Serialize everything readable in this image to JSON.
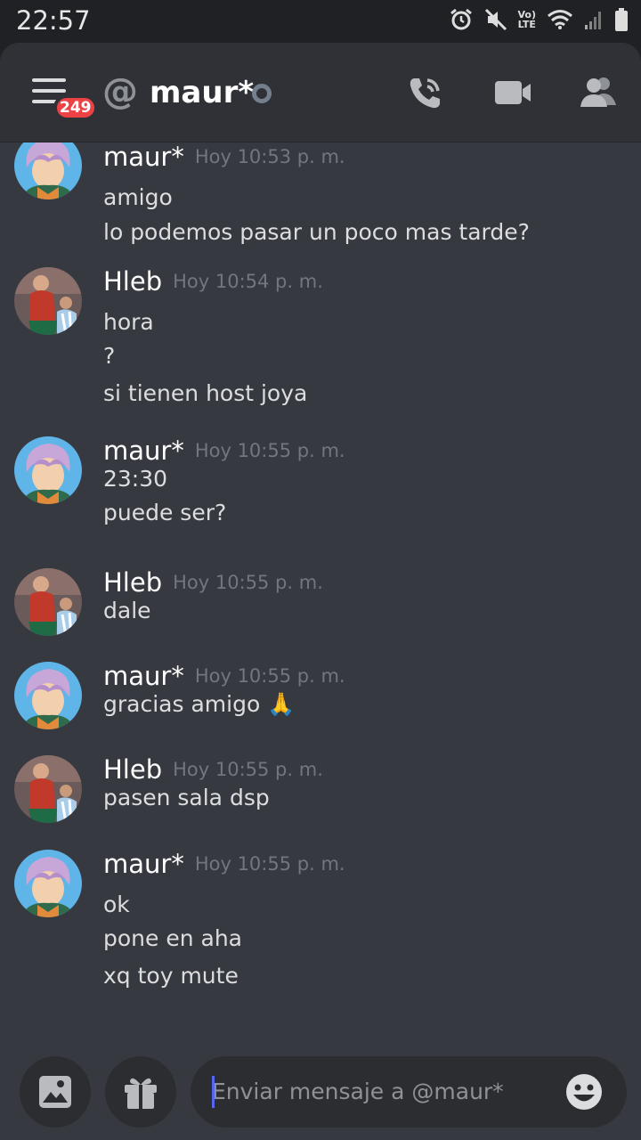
{
  "status_bar": {
    "time": "22:57",
    "volte_line1": "Vo)",
    "volte_line2": "LTE"
  },
  "header": {
    "badge_count": "249",
    "at_symbol": "@",
    "title": "maur*",
    "icons": [
      "hamburger-menu-icon",
      "phone-call-icon",
      "video-camera-icon",
      "members-icon"
    ]
  },
  "messages": [
    {
      "author": "maur*",
      "time": "Hoy 10:53 p. m.",
      "avatar": "maur",
      "lines": [
        "amigo",
        "lo podemos pasar un poco mas tarde?"
      ]
    },
    {
      "author": "Hleb",
      "time": "Hoy 10:54 p. m.",
      "avatar": "hleb",
      "lines": [
        "hora",
        "?",
        "si tienen host joya"
      ]
    },
    {
      "author": "maur*",
      "time": "Hoy 10:55 p. m.",
      "avatar": "maur",
      "lines": [
        "23:30",
        "puede ser?"
      ]
    },
    {
      "author": "Hleb",
      "time": "Hoy 10:55 p. m.",
      "avatar": "hleb",
      "lines": [
        "dale"
      ]
    },
    {
      "author": "maur*",
      "time": "Hoy 10:55 p. m.",
      "avatar": "maur",
      "lines": [
        "gracias amigo 🙏"
      ]
    },
    {
      "author": "Hleb",
      "time": "Hoy 10:55 p. m.",
      "avatar": "hleb",
      "lines": [
        "pasen sala dsp"
      ]
    },
    {
      "author": "maur*",
      "time": "Hoy 10:55 p. m.",
      "avatar": "maur",
      "lines": [
        "ok",
        "pone en aha",
        "xq toy mute"
      ]
    }
  ],
  "composer": {
    "placeholder": "Enviar mensaje a @maur*",
    "icons": [
      "image-icon",
      "gift-icon",
      "emoji-icon"
    ]
  },
  "colors": {
    "background": "#36393f",
    "header": "#2f3136",
    "badge": "#ed4245",
    "accent": "#5865f2",
    "timestamp": "#72767d"
  }
}
